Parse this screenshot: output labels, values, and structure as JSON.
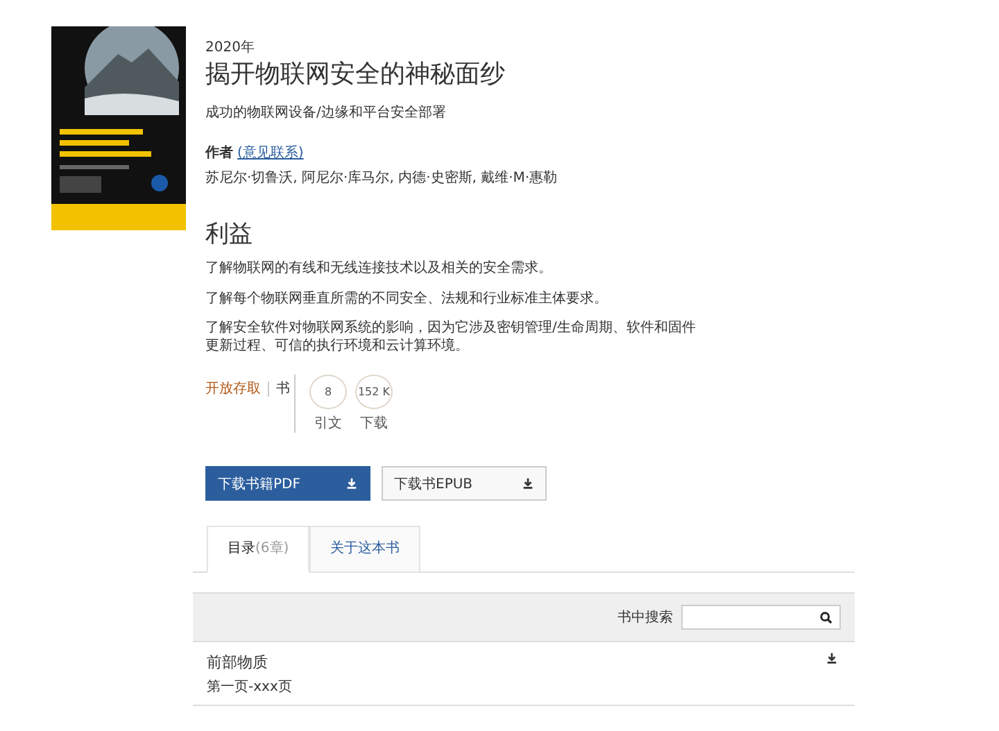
{
  "book": {
    "year": "2020年",
    "title": "揭开物联网安全的神秘面纱",
    "subtitle": "成功的物联网设备/边缘和平台安全部署",
    "author_label": "作者",
    "author_link": "(意见联系)",
    "authors": "苏尼尔·切鲁沃, 阿尼尔·库马尔, 内德·史密斯, 戴维·M·惠勒"
  },
  "benefits": {
    "heading": "利益",
    "items": [
      "了解物联网的有线和无线连接技术以及相关的安全需求。",
      "了解每个物联网垂直所需的不同安全、法规和行业标准主体要求。",
      "了解安全软件对物联网系统的影响，因为它涉及密钥管理/生命周期、软件和固件更新过程、可信的执行环境和云计算环境。"
    ]
  },
  "meta": {
    "access": "开放存取",
    "type": "书",
    "metrics": [
      {
        "value": "8",
        "label": "引文"
      },
      {
        "value": "152 K",
        "label": "下载"
      }
    ]
  },
  "downloads": [
    {
      "label": "下载书籍PDF",
      "primary": true
    },
    {
      "label": "下载书EPUB",
      "primary": false
    }
  ],
  "tabs": [
    {
      "label": "目录",
      "count": "(6章)",
      "selected": true
    },
    {
      "label": "关于这本书",
      "selected": false
    }
  ],
  "search": {
    "label": "书中搜索"
  },
  "chapters": [
    {
      "title": "前部物质",
      "pages": "第一页-xxx页"
    }
  ]
}
